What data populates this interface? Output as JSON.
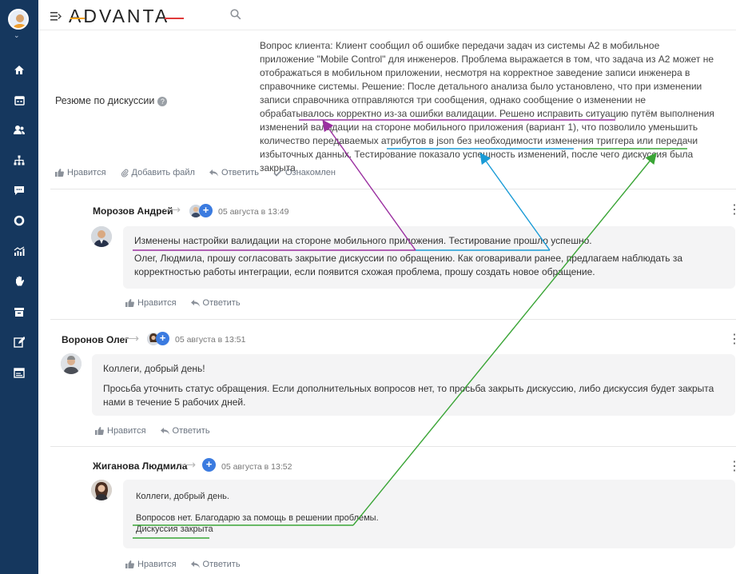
{
  "header": {
    "logo": "ADVANTA",
    "icons": [
      "menu-toggle-icon",
      "search-icon"
    ]
  },
  "sidebar": {
    "icons": [
      "home-icon",
      "calendar-icon",
      "users-icon",
      "structure-icon",
      "chat-icon",
      "cycle-icon",
      "analytics-icon",
      "hand-icon",
      "archive-icon",
      "edit-icon",
      "document-icon"
    ]
  },
  "summary": {
    "label": "Резюме по дискуссии",
    "text": "Вопрос клиента: Клиент сообщил об ошибке передачи задач из системы А2 в мобильное приложение \"Mobile Control\" для инженеров. Проблема выражается в том, что задача из А2 может не отображаться в мобильном приложении, несмотря на корректное заведение записи инженера в справочнике системы. Решение: После детального анализа было установлено, что при изменении записи справочника отправляются три сообщения, однако сообщение о изменении не обрабатывалось корректно из-за ошибки валидации. Решено исправить ситуацию путём выполнения изменений валидации на стороне мобильного приложения (вариант 1), что позволило уменьшить количество передаваемых атрибутов в json без необходимости изменения триггера или передачи избыточных данных. Тестирование показало успешность изменений, после чего дискуссия была закрыта.",
    "actions": {
      "like": "Нравится",
      "attach": "Добавить файл",
      "reply": "Ответить",
      "ack": "Ознакомлен"
    }
  },
  "comments": [
    {
      "author": "Морозов Андрей",
      "date": "05 августа в 13:49",
      "line1": "Изменены настройки валидации на стороне мобильного приложения. Тестирование прошло успешно.",
      "line2": "Олег, Людмила, прошу согласовать закрытие дискуссии по обращению. Как оговаривали ранее, предлагаем наблюдать за корректностью работы интеграции, если появится схожая проблема, прошу создать новое обращение.",
      "like": "Нравится",
      "reply": "Ответить"
    },
    {
      "author": "Воронов Олег",
      "date": "05 августа в 13:51",
      "line1": "Коллеги, добрый день!",
      "line2": "Просьба уточнить статус обращения. Если дополнительных вопросов нет, то просьба закрыть дискуссию, либо дискуссия будет закрыта нами в течение 5 рабочих дней.",
      "like": "Нравится",
      "reply": "Ответить"
    },
    {
      "author": "Жиганова Людмила",
      "date": "05 августа в 13:52",
      "line1": "Коллеги, добрый день.",
      "line2": "Вопросов нет. Благодарю за помощь в решении проблемы.",
      "line3": "Дискуссия закрыта",
      "like": "Нравится",
      "reply": "Ответить"
    }
  ],
  "colors": {
    "sidebar": "#15375e",
    "accent": "#3b7be0",
    "annotation_purple": "#9a2fa0",
    "annotation_blue": "#1a9bd6",
    "annotation_green": "#3aa536"
  }
}
